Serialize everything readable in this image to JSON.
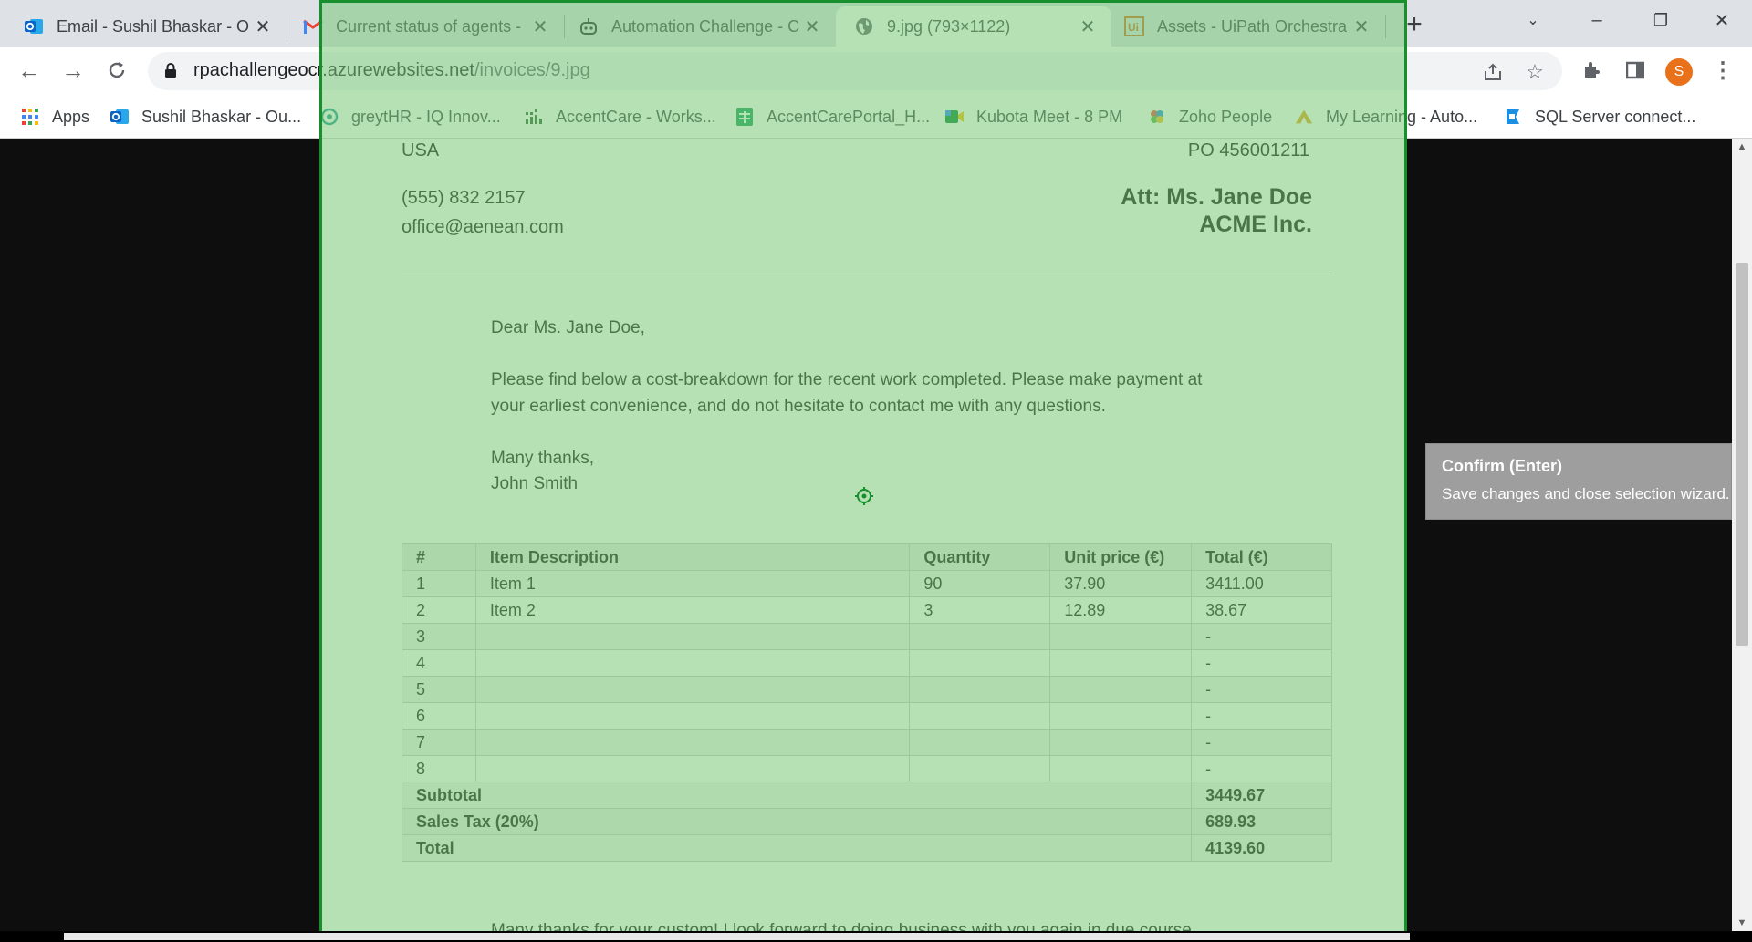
{
  "browser": {
    "tabs": [
      {
        "title": "Email - Sushil Bhaskar - O",
        "icon": "outlook-icon"
      },
      {
        "title": "Current status of agents -",
        "icon": "gmail-icon"
      },
      {
        "title": "Automation Challenge - C",
        "icon": "robot-icon"
      },
      {
        "title": "9.jpg (793×1122)",
        "icon": "globe-icon"
      },
      {
        "title": "Assets - UiPath Orchestra",
        "icon": "uipath-icon"
      }
    ],
    "url_domain": "rpachallengeocr.azurewebsites.net",
    "url_path": "/invoices/9.jpg",
    "profile_initial": "S",
    "bookmarks": [
      {
        "label": "Apps",
        "icon": "apps-grid-icon"
      },
      {
        "label": "Sushil Bhaskar - Ou...",
        "icon": "outlook-icon"
      },
      {
        "label": "greytHR - IQ Innov...",
        "icon": "greythr-icon"
      },
      {
        "label": "AccentCare - Works...",
        "icon": "accentcare-icon"
      },
      {
        "label": "AccentCarePortal_H...",
        "icon": "sheets-icon"
      },
      {
        "label": "Kubota Meet - 8 PM",
        "icon": "meet-icon"
      },
      {
        "label": "Zoho People",
        "icon": "zoho-icon"
      },
      {
        "label": "My Learning - Auto...",
        "icon": "learning-icon"
      },
      {
        "label": "SQL Server connect...",
        "icon": "sqlserver-icon"
      }
    ]
  },
  "invoice": {
    "country": "USA",
    "po": "PO 456001211",
    "phone": "(555) 832 2157",
    "email": "office@aenean.com",
    "attention": "Att: Ms. Jane Doe",
    "company": "ACME Inc.",
    "greeting": "Dear Ms. Jane Doe,",
    "body_line1": "Please find below a cost-breakdown for the recent work completed. Please make payment at",
    "body_line2": "your earliest convenience, and do not hesitate to contact me with any questions.",
    "signoff": "Many thanks,",
    "signature": "John Smith",
    "table": {
      "headers": [
        "#",
        "Item Description",
        "Quantity",
        "Unit price (€)",
        "Total (€)"
      ],
      "rows": [
        [
          "1",
          "Item 1",
          "90",
          "37.90",
          "3411.00"
        ],
        [
          "2",
          "Item 2",
          "3",
          "12.89",
          "38.67"
        ],
        [
          "3",
          "",
          "",
          "",
          "-"
        ],
        [
          "4",
          "",
          "",
          "",
          "-"
        ],
        [
          "5",
          "",
          "",
          "",
          "-"
        ],
        [
          "6",
          "",
          "",
          "",
          "-"
        ],
        [
          "7",
          "",
          "",
          "",
          "-"
        ],
        [
          "8",
          "",
          "",
          "",
          "-"
        ]
      ],
      "subtotal_label": "Subtotal",
      "subtotal": "3449.67",
      "tax_label": "Sales Tax (20%)",
      "tax": "689.93",
      "total_label": "Total",
      "total": "4139.60"
    },
    "footer_partial": "Many thanks for your custom! I look forward to doing business with you again in due course."
  },
  "tooltip": {
    "title": "Confirm (Enter)",
    "text": "Save changes and close selection wizard."
  },
  "colors": {
    "selection_overlay": "#78c878",
    "selection_border": "#178f2c",
    "tooltip_bg": "#9e9e9e",
    "avatar": "#e8711a"
  }
}
